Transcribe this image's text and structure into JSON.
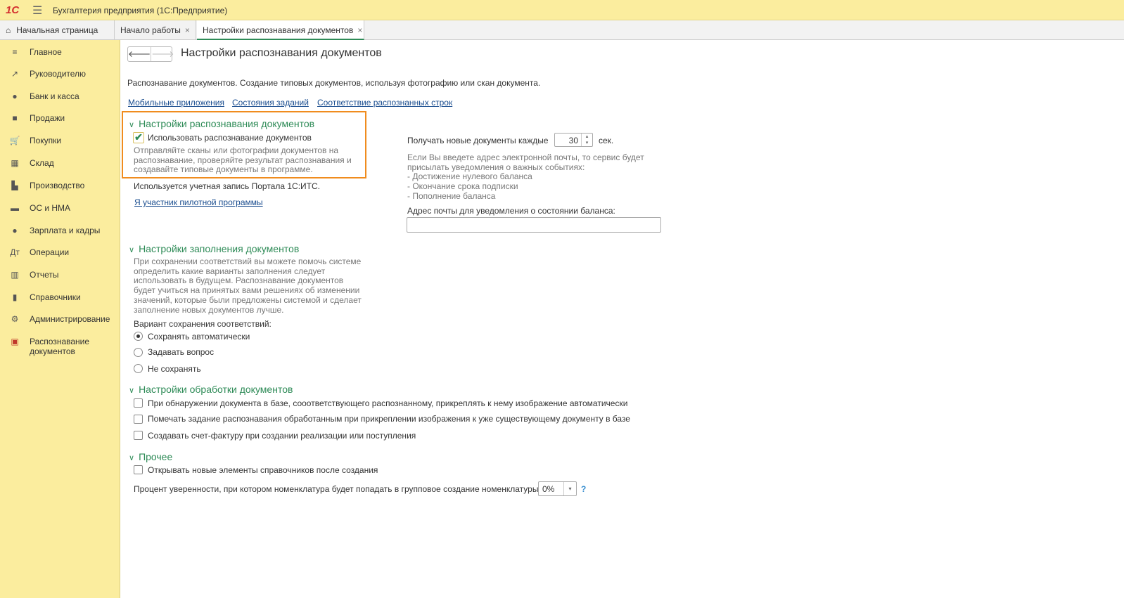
{
  "app": {
    "title": "Бухгалтерия предприятия  (1С:Предприятие)",
    "logo": "1С"
  },
  "tabs": [
    {
      "label": "Начальная страница"
    },
    {
      "label": "Начало работы"
    },
    {
      "label": "Настройки распознавания документов"
    }
  ],
  "sidebar": {
    "items": [
      {
        "label": "Главное",
        "icon": "≡"
      },
      {
        "label": "Руководителю",
        "icon": "↗"
      },
      {
        "label": "Банк и касса",
        "icon": "●"
      },
      {
        "label": "Продажи",
        "icon": "■"
      },
      {
        "label": "Покупки",
        "icon": "🛒"
      },
      {
        "label": "Склад",
        "icon": "▦"
      },
      {
        "label": "Производство",
        "icon": "▙"
      },
      {
        "label": "ОС и НМА",
        "icon": "▬"
      },
      {
        "label": "Зарплата и кадры",
        "icon": "●"
      },
      {
        "label": "Операции",
        "icon": "Дт"
      },
      {
        "label": "Отчеты",
        "icon": "▥"
      },
      {
        "label": "Справочники",
        "icon": "▮"
      },
      {
        "label": "Администрирование",
        "icon": "⚙"
      },
      {
        "label": "Распознавание документов",
        "icon": "▣"
      }
    ]
  },
  "page": {
    "title": "Настройки распознавания документов",
    "description": "Распознавание документов. Создание типовых документов, используя фотографию или скан документа.",
    "links": [
      "Мобильные приложения",
      "Состояния заданий",
      "Соответствие распознанных строк"
    ],
    "recognition": {
      "title": "Настройки распознавания документов",
      "use_label": "Использовать распознавание документов",
      "use_checked": true,
      "hint": [
        "Отправляйте сканы или фотографии документов на",
        "распознавание, проверяйте результат распознавания и",
        "создавайте типовые документы в программе."
      ],
      "account": "Используется учетная запись Портала 1С:ИТС.",
      "pilot_link": "Я участник пилотной программы",
      "interval_label": "Получать новые документы каждые",
      "interval_value": "30",
      "interval_unit": "сек.",
      "email_note": [
        "Если Вы введете адрес электронной почты, то сервис будет",
        "присылать уведомления о важных событиях:",
        "- Достижение нулевого баланса",
        "- Окончание срока подписки",
        "- Пополнение баланса"
      ],
      "email_label": "Адрес почты для уведомления о состоянии баланса:",
      "email_value": ""
    },
    "filling": {
      "title": "Настройки заполнения документов",
      "hint": [
        "При сохранении соответствий вы можете помочь системе",
        "определить какие варианты заполнения следует",
        "использовать в будущем. Распознавание документов",
        "будет учиться на принятых вами решениях об изменении",
        "значений, которые были предложены системой и сделает",
        "заполнение новых документов лучше."
      ],
      "variant_label": "Вариант сохранения соответствий:",
      "options": [
        "Сохранять автоматически",
        "Задавать вопрос",
        "Не сохранять"
      ],
      "selected": 0
    },
    "processing": {
      "title": "Настройки обработки документов",
      "options": [
        "При обнаружении документа в базе, сооответствующего распознанному, прикреплять к нему изображение автоматически",
        "Помечать задание распознавания обработанным при прикреплении изображения к уже существующему документу в базе",
        "Создавать счет-фактуру при создании реализации или поступления"
      ]
    },
    "other": {
      "title": "Прочее",
      "open_label": "Открывать новые элементы справочников после создания",
      "percent_label": "Процент уверенности, при котором номенклатура будет попадать в групповое создание номенклатуры:",
      "percent_value": "0%",
      "help": "?"
    }
  }
}
